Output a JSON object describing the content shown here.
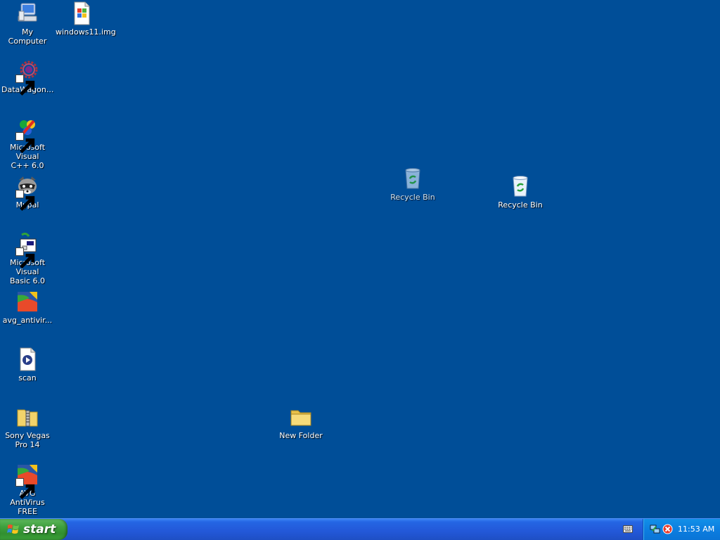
{
  "desktop": {
    "icons": [
      {
        "id": "my-computer",
        "label": "My Computer",
        "icon": "computer-icon"
      },
      {
        "id": "windows11-img",
        "label": "windows11.img",
        "icon": "disc-image-file-icon"
      },
      {
        "id": "datawagon",
        "label": "DataWagon...",
        "icon": "datawagon-icon"
      },
      {
        "id": "msvc",
        "label": "Microsoft Visual\nC++ 6.0",
        "icon": "visual-cpp-icon"
      },
      {
        "id": "mypal",
        "label": "Mypal",
        "icon": "mypal-raccoon-icon"
      },
      {
        "id": "msvb",
        "label": "Microsoft Visual\nBasic 6.0",
        "icon": "visual-basic-icon"
      },
      {
        "id": "avg-antivir",
        "label": "avg_antivir...",
        "icon": "avg-installer-icon"
      },
      {
        "id": "scan",
        "label": "scan",
        "icon": "media-file-icon"
      },
      {
        "id": "sony-vegas",
        "label": "Sony Vegas\nPro 14",
        "icon": "zip-folder-icon"
      },
      {
        "id": "avg-free",
        "label": "AVG AntiVirus\nFREE",
        "icon": "avg-icon"
      },
      {
        "id": "recycle-bin-1",
        "label": "Recycle Bin",
        "icon": "recycle-bin-icon"
      },
      {
        "id": "recycle-bin-2",
        "label": "Recycle Bin",
        "icon": "recycle-bin-icon"
      },
      {
        "id": "new-folder",
        "label": "New Folder",
        "icon": "folder-icon"
      }
    ]
  },
  "taskbar": {
    "start_label": "start",
    "clock": "11:53 AM"
  },
  "colors": {
    "desktop_bg": "#004e98",
    "taskbar_blue": "#2358d8",
    "start_green": "#3d9e3c",
    "tray_blue": "#0c7ee0"
  }
}
